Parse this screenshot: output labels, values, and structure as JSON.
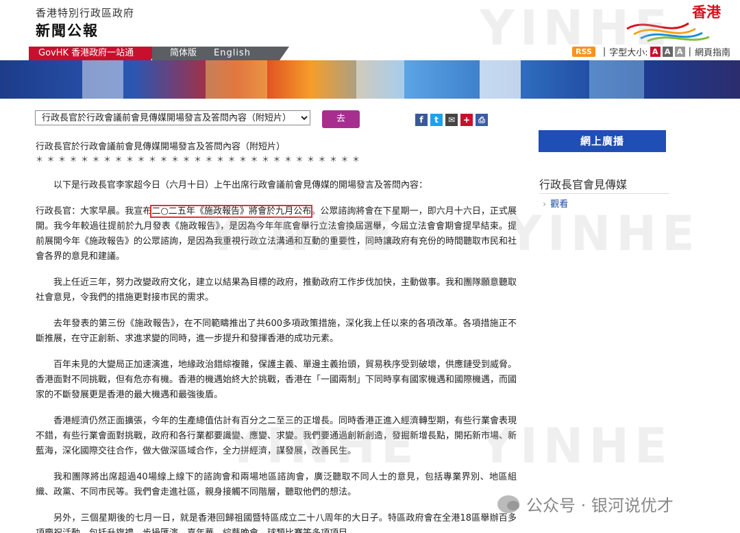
{
  "header": {
    "org_name": "香港特別行政區政府",
    "site_name": "新聞公報",
    "brand": "香港"
  },
  "nav": {
    "govhk": "GovHK 香港政府一站通",
    "simplified": "简体版",
    "english": "English",
    "rss": "RSS",
    "font_size_label": "字型大小:",
    "font_sizes": [
      "A",
      "A",
      "A"
    ],
    "page_guide": "網頁指南"
  },
  "toolbar": {
    "select_value": "行政長官於行政會議前會見傳媒開場發言及答問內容（附短片）",
    "go_label": "去",
    "share_icons": [
      "facebook-icon",
      "twitter-icon",
      "email-icon",
      "bookmark-icon",
      "print-icon"
    ]
  },
  "article": {
    "title": "行政長官於行政會議前會見傳媒開場發言及答問內容（附短片）",
    "stars": "＊＊＊＊＊＊＊＊＊＊＊＊＊＊＊＊＊＊＊＊＊＊＊＊＊＊＊＊＊",
    "intro": "以下是行政長官李家超今日（六月十日）上午出席行政會議前會見傳媒的開場發言及答問內容：",
    "p1_before": "行政長官：大家早晨。我宣布",
    "p1_highlight": "二○二五年《施政報告》將會於九月公布",
    "p1_after": "。公眾諮詢將會在下星期一，即六月十六日，正式展開。我今年較過往提前於九月發表《施政報告》，是因為今年年底會舉行立法會換屆選舉，今屆立法會會期會提早結束。提前展開今年《施政報告》的公眾諮詢，是因為我重視行政立法溝通和互動的重要性，同時讓政府有充份的時間聽取市民和社會各界的意見和建議。",
    "p2": "我上任近三年，努力改變政府文化，建立以結果為目標的政府，推動政府工作步伐加快，主動做事。我和團隊願意聽取社會意見，令我們的措施更對接市民的需求。",
    "p3": "去年發表的第三份《施政報告》，在不同範疇推出了共600多項政策措施，深化我上任以來的各項改革。各項措施正不斷推展，在守正創新、求進求變的同時，進一步提升和發揮香港的成功元素。",
    "p4": "百年未見的大變局正加速演進，地緣政治錯綜複雜，保護主義、單邊主義抬頭，貿易秩序受到破壞，供應鏈受到威脅。香港面對不同挑戰，但有危亦有機。香港的機遇始終大於挑戰，香港在「一國兩制」下同時享有國家機遇和國際機遇，而國家的不斷發展更是香港的最大機遇和最強後盾。",
    "p5": "香港經濟仍然正面擴張，今年的生產總值估計有百分之二至三的正增長。同時香港正進入經濟轉型期，有些行業會表現不錯，有些行業會面對挑戰，政府和各行業都要識變、應變、求變。我們要通過創新創造，發掘新增長點，開拓新市場、新藍海，深化國際交往合作，做大做深區域合作，全力拼經濟，謀發展，改善民生。",
    "p6": "我和團隊將出席超過40場線上線下的諮詢會和兩場地區諮詢會，廣泛聽取不同人士的意見，包括專業界別、地區組織、政黨、不同市民等。我們會走進社區，親身接觸不同階層，聽取他們的想法。",
    "p7": "另外，三個星期後的七月一日，就是香港回歸祖國暨特區成立二十八周年的大日子。特區政府會在全港18區舉辦百多項慶祝活動，包括升旗禮、步操匯演、嘉年華、綜藝晚會、球類比賽等多項項目。"
  },
  "sidebar": {
    "live_button": "網上廣播",
    "heading": "行政長官會見傳媒",
    "link": "觀看"
  },
  "watermark": "YINHE",
  "credit": "公众号 · 银河说优才"
}
